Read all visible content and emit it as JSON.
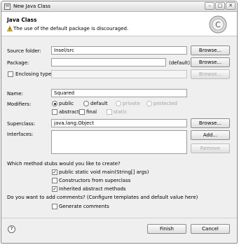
{
  "window": {
    "title": "New Java Class",
    "controls": {
      "minimize": "–",
      "maximize": "□",
      "close": "✕"
    }
  },
  "header": {
    "title": "Java Class",
    "message": "The use of the default package is discouraged."
  },
  "form": {
    "source_folder": {
      "label": "Source folder:",
      "value": "Insel/src",
      "browse": "Browse..."
    },
    "package": {
      "label": "Package:",
      "value": "",
      "hint": "(default)",
      "browse": "Browse..."
    },
    "enclosing_type": {
      "label": "Enclosing type:",
      "value": "",
      "browse": "Browse..."
    },
    "name": {
      "label": "Name:",
      "value": "Squared"
    },
    "modifiers": {
      "label": "Modifiers:",
      "public": "public",
      "default": "default",
      "private": "private",
      "protected": "protected",
      "abstract": "abstract",
      "final": "final",
      "static": "static"
    },
    "superclass": {
      "label": "Superclass:",
      "value": "java.lang.Object",
      "browse": "Browse..."
    },
    "interfaces": {
      "label": "Interfaces:",
      "add": "Add...",
      "remove": "Remove"
    },
    "stubs": {
      "question": "Which method stubs would you like to create?",
      "main": "public static void main(String[] args)",
      "constructors": "Constructors from superclass",
      "inherited": "Inherited abstract methods"
    },
    "comments": {
      "question": "Do you want to add comments? (Configure templates and default value here)",
      "generate": "Generate comments"
    }
  },
  "footer": {
    "help": "?",
    "finish": "Finish",
    "cancel": "Cancel"
  },
  "icons": {
    "warning": "warning-icon",
    "banner": "new-class-wizard-icon",
    "check": "✓"
  }
}
